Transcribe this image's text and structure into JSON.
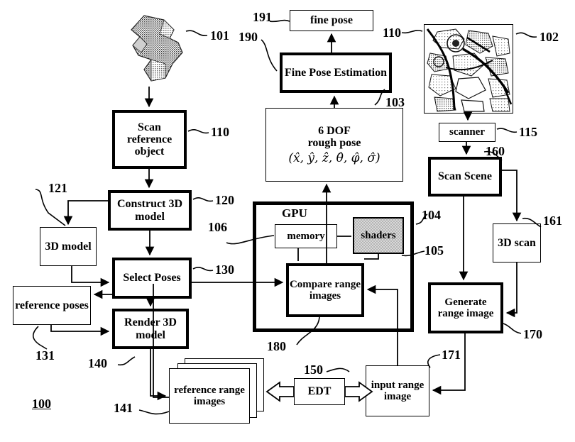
{
  "figure": {
    "label": "100",
    "type": "patent-flow-diagram"
  },
  "blocks": {
    "scan_reference_object": "Scan reference object",
    "construct_3d_model": "Construct 3D model",
    "three_d_model": "3D model",
    "select_poses": "Select Poses",
    "reference_poses": "reference poses",
    "render_3d_model": "Render 3D model",
    "reference_range_images": "reference range images",
    "edt": "EDT",
    "input_range_image": "input range image",
    "generate_range_image": "Generate range image",
    "three_d_scan": "3D scan",
    "scan_scene": "Scan Scene",
    "scanner": "scanner",
    "gpu": "GPU",
    "memory": "memory",
    "shaders": "shaders",
    "compare_range_images": "Compare range images",
    "six_dof_title": "6 DOF",
    "six_dof_sub": "rough pose",
    "six_dof_math": "(x̂, ŷ, ẑ, θ̂, φ̂, σ̂)",
    "fine_pose_estimation": "Fine Pose Estimation",
    "fine_pose": "fine pose"
  },
  "ref_numbers": {
    "n101": "101",
    "n102": "102",
    "n103": "103",
    "n104": "104",
    "n105": "105",
    "n106": "106",
    "n110_left": "110",
    "n110_right": "110",
    "n115": "115",
    "n120": "120",
    "n121": "121",
    "n130": "130",
    "n131": "131",
    "n140": "140",
    "n141": "141",
    "n150": "150",
    "n160": "160",
    "n161": "161",
    "n170": "170",
    "n171": "171",
    "n180": "180",
    "n190": "190",
    "n191": "191",
    "n100": "100"
  },
  "colors": {
    "stroke": "#000000",
    "background": "#ffffff",
    "shader_fill": "#d9d9d9"
  }
}
